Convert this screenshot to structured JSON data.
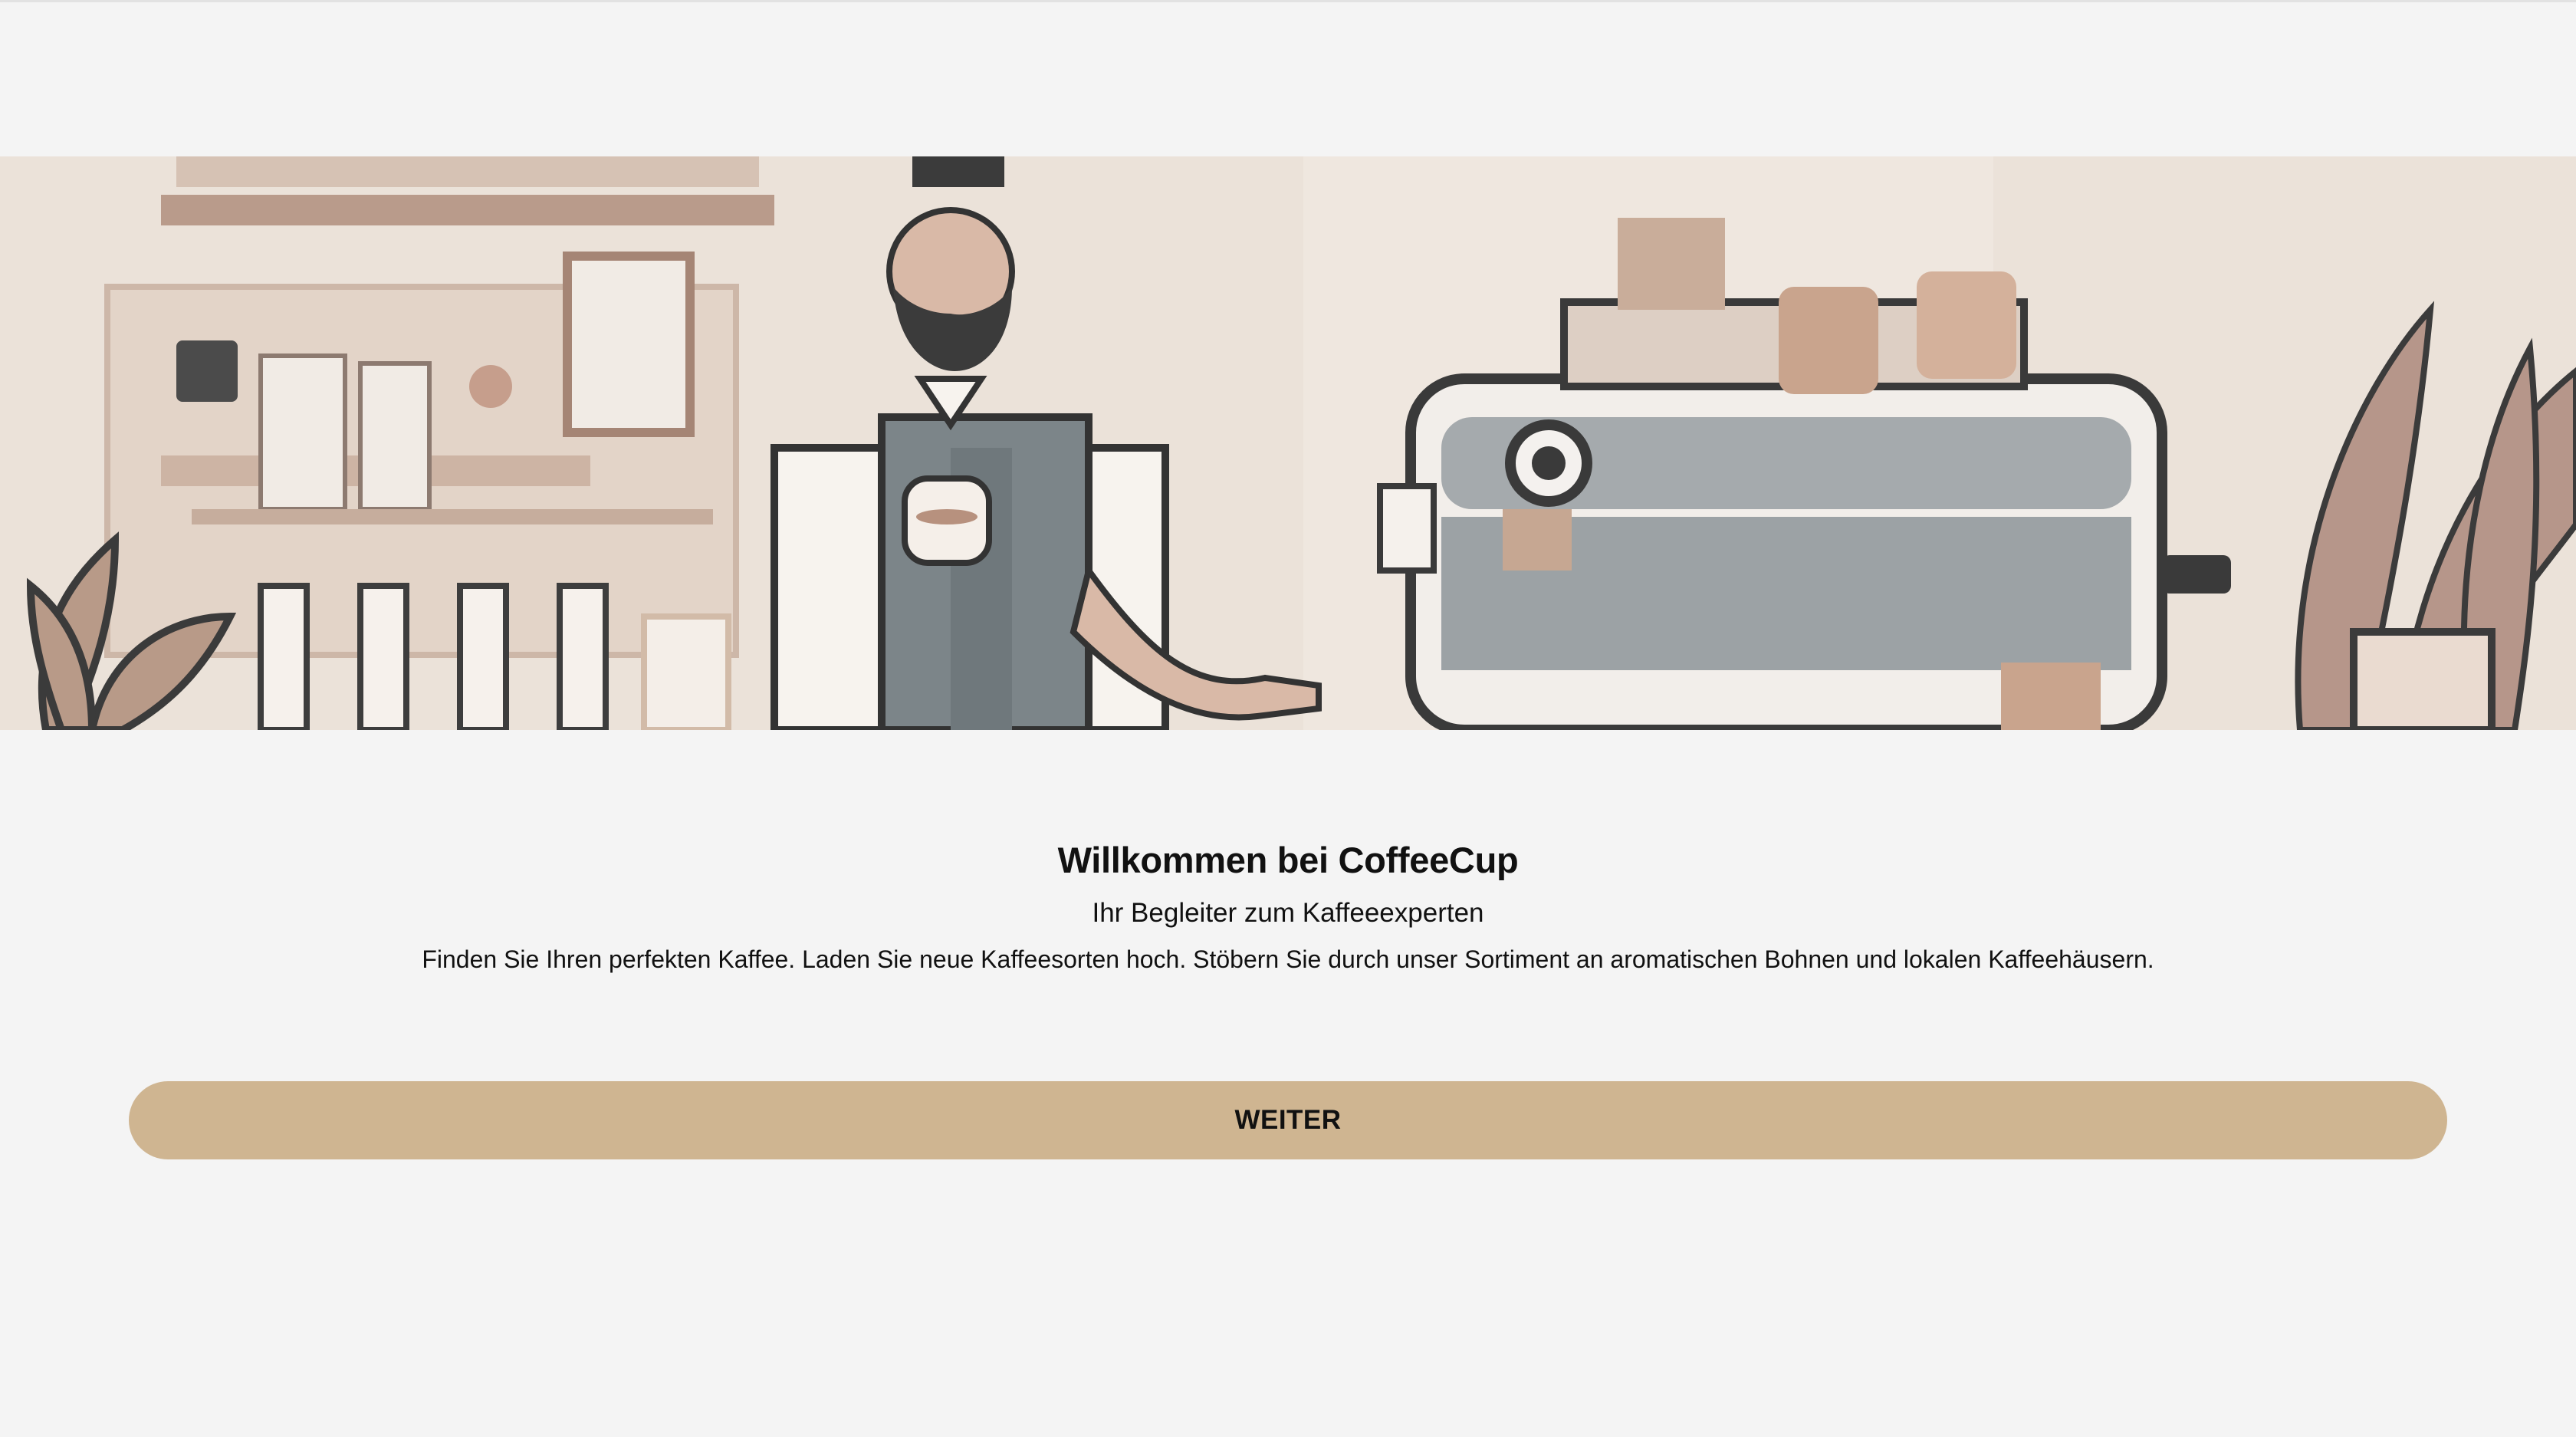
{
  "welcome": {
    "title": "Willkommen bei CoffeeCup",
    "subtitle": "Ihr Begleiter zum Kaffeeexperten",
    "description": "Finden Sie Ihren perfekten Kaffee. Laden Sie neue Kaffeesorten hoch. Stöbern Sie durch unser Sortiment an aromatischen Bohnen und lokalen Kaffeehäusern."
  },
  "actions": {
    "continue_label": "WEITER"
  },
  "colors": {
    "background": "#f4f4f4",
    "button": "#cfb591",
    "hero_tone": "#e6d9cc"
  },
  "hero": {
    "illustration": "barista-coffee-shop-illustration"
  }
}
